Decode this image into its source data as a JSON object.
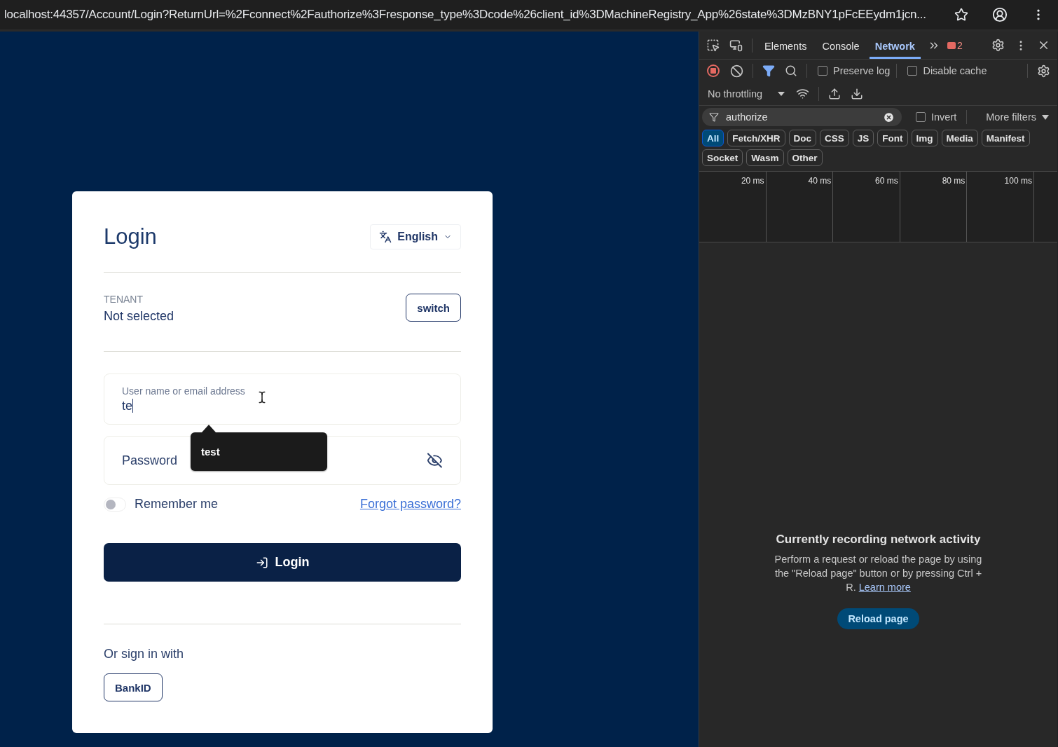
{
  "browser": {
    "url": "localhost:44357/Account/Login?ReturnUrl=%2Fconnect%2Fauthorize%3Fresponse_type%3Dcode%26client_id%3DMachineRegistry_App%26state%3DMzBNY1pFcEEydm1jcn..."
  },
  "login": {
    "title": "Login",
    "language": "English",
    "tenant": {
      "label": "TENANT",
      "value": "Not selected",
      "button": "switch"
    },
    "username": {
      "label": "User name or email address",
      "value": "te"
    },
    "autocomplete": {
      "suggestion": "test"
    },
    "password": {
      "placeholder": "Password"
    },
    "remember": {
      "label": "Remember me",
      "on": false
    },
    "forgot": "Forgot password?",
    "submit": "Login",
    "alt_heading": "Or sign in with",
    "providers": [
      "BankID"
    ]
  },
  "devtools": {
    "tabs": [
      {
        "label": "Elements",
        "selected": false
      },
      {
        "label": "Console",
        "selected": false
      },
      {
        "label": "Network",
        "selected": true
      }
    ],
    "error_count": "2",
    "preserve_log": {
      "label": "Preserve log",
      "checked": false
    },
    "disable_cache": {
      "label": "Disable cache",
      "checked": false
    },
    "throttling": "No throttling",
    "filter": {
      "value": "authorize"
    },
    "invert": {
      "label": "Invert",
      "checked": false
    },
    "more_filters": "More filters",
    "types": [
      {
        "label": "All",
        "selected": true
      },
      {
        "label": "Fetch/XHR",
        "selected": false
      },
      {
        "label": "Doc",
        "selected": false
      },
      {
        "label": "CSS",
        "selected": false
      },
      {
        "label": "JS",
        "selected": false
      },
      {
        "label": "Font",
        "selected": false
      },
      {
        "label": "Img",
        "selected": false
      },
      {
        "label": "Media",
        "selected": false
      },
      {
        "label": "Manifest",
        "selected": false
      },
      {
        "label": "Socket",
        "selected": false
      },
      {
        "label": "Wasm",
        "selected": false
      },
      {
        "label": "Other",
        "selected": false
      }
    ],
    "timeline": {
      "ticks": [
        "20 ms",
        "40 ms",
        "60 ms",
        "80 ms",
        "100 ms"
      ]
    },
    "empty": {
      "title": "Currently recording network activity",
      "text": "Perform a request or reload the page by using the \"Reload page\" button or by pressing Ctrl + R.",
      "link": "Learn more",
      "button": "Reload page"
    }
  }
}
